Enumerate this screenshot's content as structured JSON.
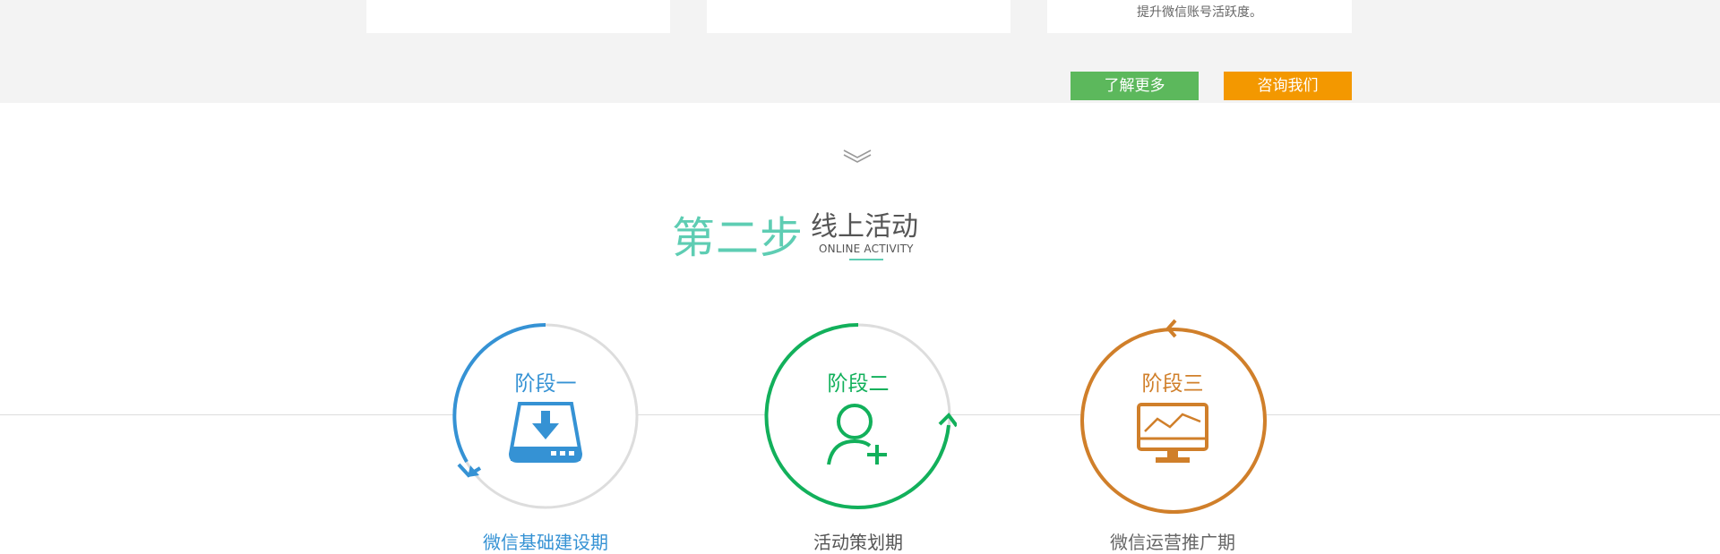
{
  "top_cards": {
    "card3_text": "提升微信账号活跃度。"
  },
  "buttons": {
    "learn_more": "了解更多",
    "contact_us": "咨询我们"
  },
  "section": {
    "step_label": "第二步",
    "title": "线上活动",
    "subtitle": "ONLINE ACTIVITY"
  },
  "stages": [
    {
      "label": "阶段一",
      "icon": "download-drive-icon",
      "color": "#3592d4",
      "caption": "微信基础建设期"
    },
    {
      "label": "阶段二",
      "icon": "add-user-icon",
      "color": "#12b05b",
      "caption": "活动策划期"
    },
    {
      "label": "阶段三",
      "icon": "monitor-chart-icon",
      "color": "#d07f2a",
      "caption": "微信运营推广期"
    }
  ],
  "colors": {
    "accent_teal": "#5ecdb3",
    "learn_more_bg": "#5cb85c",
    "contact_bg": "#f39800",
    "band_bg": "#f3f3f3"
  }
}
